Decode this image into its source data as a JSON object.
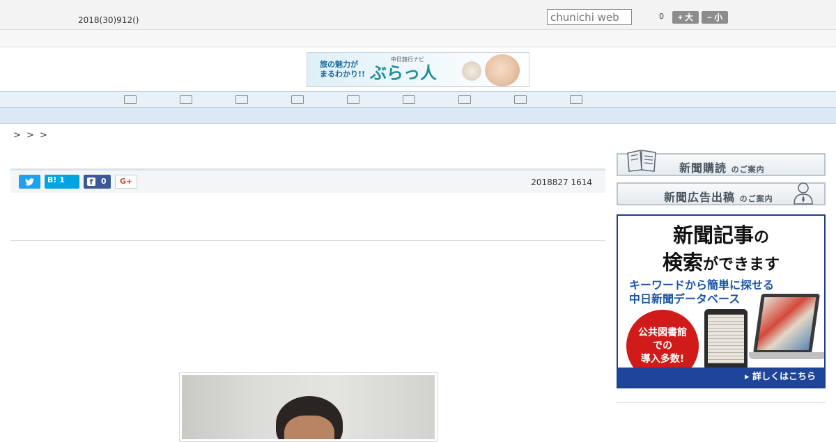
{
  "header": {
    "date": "2018(30)912()",
    "search_placeholder": "chunichi web",
    "font_size_value": "0",
    "font_bigger_label": "+ 大",
    "font_smaller_label": "− 小"
  },
  "banner": {
    "tagline_line1": "旅の魅力が",
    "tagline_line2": "まるわかり!!",
    "navi": "中日旅行ナビ",
    "brand": "ぶらっ人"
  },
  "nav": {
    "items": [
      "",
      "",
      "",
      "",
      "",
      "",
      "",
      "",
      ""
    ]
  },
  "breadcrumb": "> > >",
  "share": {
    "hatena_label": "B! 1",
    "facebook_count": "0",
    "gplus_label": "G+",
    "timestamp": "2018827 1614"
  },
  "sidebar": {
    "subscribe_big": "新聞購読",
    "subscribe_small": "のご案内",
    "ad_big": "新聞広告出稿",
    "ad_small": "のご案内",
    "db_ad": {
      "headline_line1_a": "新聞記事",
      "headline_line1_b": "の",
      "headline_line2_a": "検索",
      "headline_line2_b": "ができます",
      "sub_line1": "キーワードから簡単に探せる",
      "sub_line2": "中日新聞データベース",
      "circle_line1": "公共図書館",
      "circle_line2": "での",
      "circle_line3": "導入多数!",
      "footer": "▸ 詳しくはこちら"
    }
  },
  "colors": {
    "nav_bg": "#e8f1f9",
    "twitter": "#1da1f2",
    "hatena": "#00a4de",
    "facebook": "#3b5998",
    "ad_blue": "#1e4599",
    "ad_red": "#d11a1a"
  }
}
